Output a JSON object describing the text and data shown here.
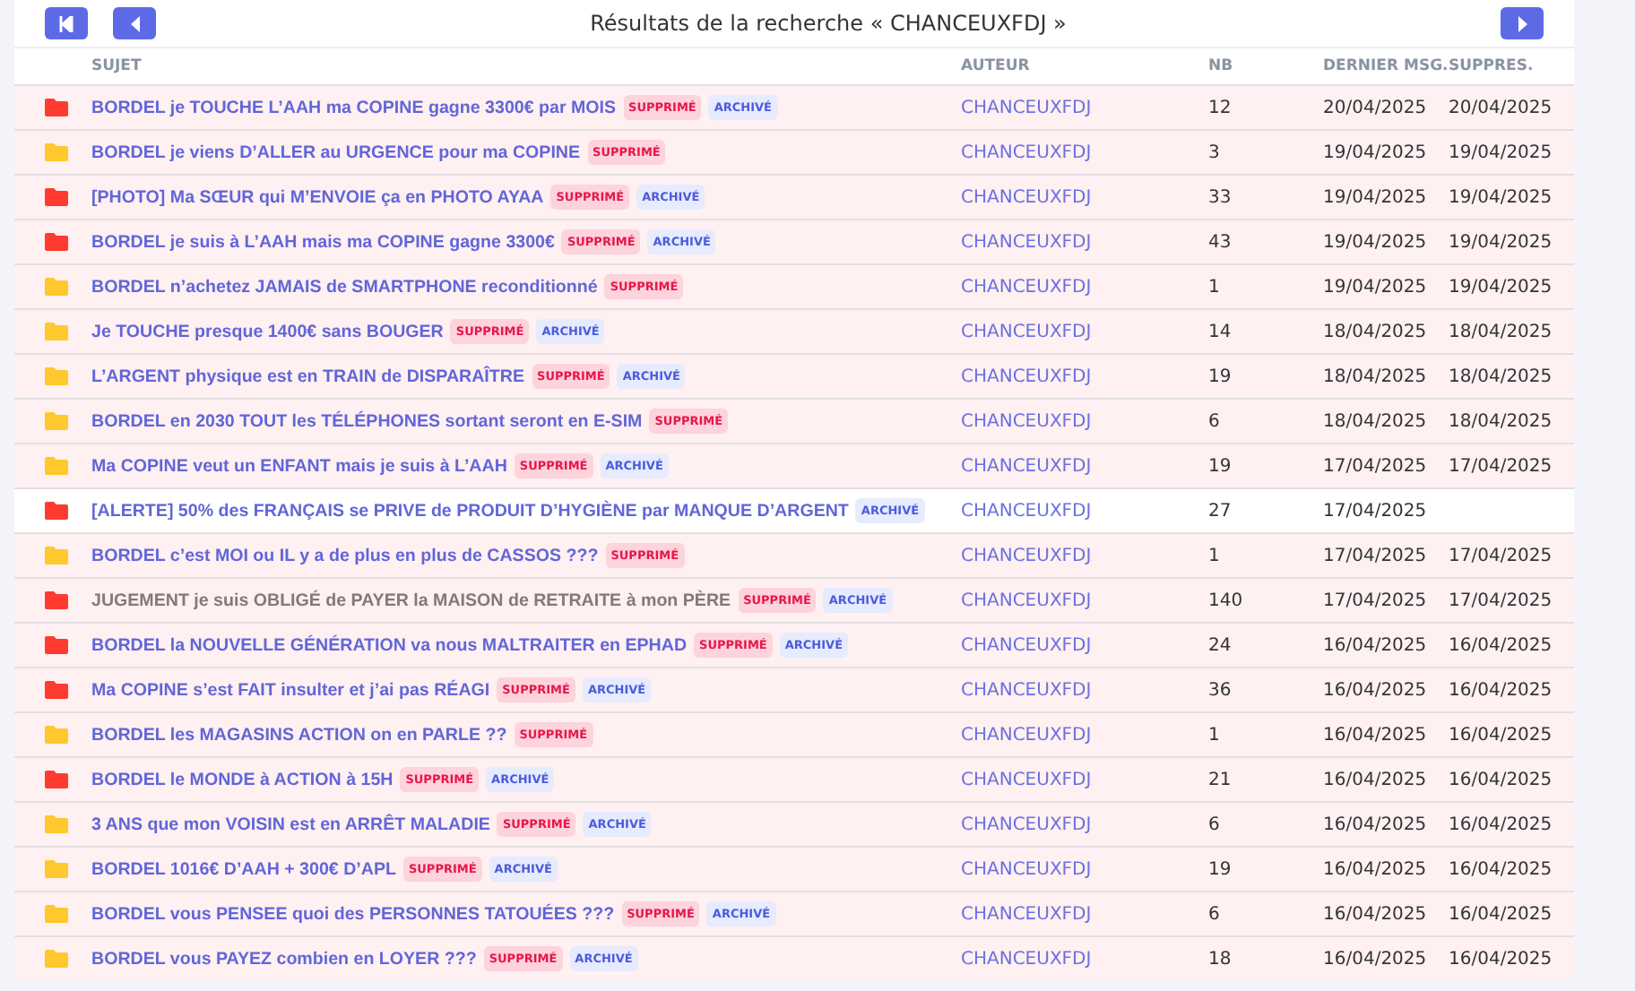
{
  "toolbar": {
    "title": "Résultats de la recherche « CHANCEUXFDJ »"
  },
  "table": {
    "columns": [
      "SUJET",
      "AUTEUR",
      "NB",
      "DERNIER MSG.",
      "SUPPRES."
    ],
    "rows": [
      {
        "subject": "BORDEL je TOUCHE L’AAH ma COPINE gagne 3300€ par MOIS",
        "color": "#ff3b30",
        "deleted": true,
        "visited": false,
        "tags": [
          {
            "kind": "deleted",
            "label": "SUPPRIMÉ"
          },
          {
            "kind": "archived",
            "label": "ARCHIVÉ"
          }
        ],
        "author": "CHANCEUXFDJ",
        "count": "12",
        "last": "20/04/2025",
        "removed": "20/04/2025"
      },
      {
        "subject": "BORDEL je viens D’ALLER au URGENCE pour ma COPINE",
        "color": "#ffc82c",
        "deleted": true,
        "visited": false,
        "tags": [
          {
            "kind": "deleted",
            "label": "SUPPRIMÉ"
          }
        ],
        "author": "CHANCEUXFDJ",
        "count": "3",
        "last": "19/04/2025",
        "removed": "19/04/2025"
      },
      {
        "subject": "[PHOTO] Ma SŒUR qui M’ENVOIE ça en PHOTO AYAA",
        "color": "#ff3b30",
        "deleted": true,
        "visited": false,
        "tags": [
          {
            "kind": "deleted",
            "label": "SUPPRIMÉ"
          },
          {
            "kind": "archived",
            "label": "ARCHIVÉ"
          }
        ],
        "author": "CHANCEUXFDJ",
        "count": "33",
        "last": "19/04/2025",
        "removed": "19/04/2025"
      },
      {
        "subject": "BORDEL je suis à L’AAH mais ma COPINE gagne 3300€",
        "color": "#ff3b30",
        "deleted": true,
        "visited": false,
        "tags": [
          {
            "kind": "deleted",
            "label": "SUPPRIMÉ"
          },
          {
            "kind": "archived",
            "label": "ARCHIVÉ"
          }
        ],
        "author": "CHANCEUXFDJ",
        "count": "43",
        "last": "19/04/2025",
        "removed": "19/04/2025"
      },
      {
        "subject": "BORDEL n’achetez JAMAIS de SMARTPHONE reconditionné",
        "color": "#ffc82c",
        "deleted": true,
        "visited": false,
        "tags": [
          {
            "kind": "deleted",
            "label": "SUPPRIMÉ"
          }
        ],
        "author": "CHANCEUXFDJ",
        "count": "1",
        "last": "19/04/2025",
        "removed": "19/04/2025"
      },
      {
        "subject": "Je TOUCHE presque 1400€ sans BOUGER",
        "color": "#ffc82c",
        "deleted": true,
        "visited": false,
        "tags": [
          {
            "kind": "deleted",
            "label": "SUPPRIMÉ"
          },
          {
            "kind": "archived",
            "label": "ARCHIVÉ"
          }
        ],
        "author": "CHANCEUXFDJ",
        "count": "14",
        "last": "18/04/2025",
        "removed": "18/04/2025"
      },
      {
        "subject": "L’ARGENT physique est en TRAIN de DISPARAÎTRE",
        "color": "#ffc82c",
        "deleted": true,
        "visited": false,
        "tags": [
          {
            "kind": "deleted",
            "label": "SUPPRIMÉ"
          },
          {
            "kind": "archived",
            "label": "ARCHIVÉ"
          }
        ],
        "author": "CHANCEUXFDJ",
        "count": "19",
        "last": "18/04/2025",
        "removed": "18/04/2025"
      },
      {
        "subject": "BORDEL en 2030 TOUT les TÉLÉPHONES sortant seront en E-SIM",
        "color": "#ffc82c",
        "deleted": true,
        "visited": false,
        "tags": [
          {
            "kind": "deleted",
            "label": "SUPPRIMÉ"
          }
        ],
        "author": "CHANCEUXFDJ",
        "count": "6",
        "last": "18/04/2025",
        "removed": "18/04/2025"
      },
      {
        "subject": "Ma COPINE veut un ENFANT mais je suis à L’AAH",
        "color": "#ffc82c",
        "deleted": true,
        "visited": false,
        "tags": [
          {
            "kind": "deleted",
            "label": "SUPPRIMÉ"
          },
          {
            "kind": "archived",
            "label": "ARCHIVÉ"
          }
        ],
        "author": "CHANCEUXFDJ",
        "count": "19",
        "last": "17/04/2025",
        "removed": "17/04/2025"
      },
      {
        "subject": "[ALERTE] 50% des FRANÇAIS se PRIVE de PRODUIT D’HYGIÈNE par MANQUE D’ARGENT",
        "color": "#ff3b30",
        "deleted": false,
        "visited": false,
        "tags": [
          {
            "kind": "archived",
            "label": "ARCHIVÉ"
          }
        ],
        "author": "CHANCEUXFDJ",
        "count": "27",
        "last": "17/04/2025"
      },
      {
        "subject": "BORDEL c’est MOI ou IL y a de plus en plus de CASSOS ???",
        "color": "#ffc82c",
        "deleted": true,
        "visited": false,
        "tags": [
          {
            "kind": "deleted",
            "label": "SUPPRIMÉ"
          }
        ],
        "author": "CHANCEUXFDJ",
        "count": "1",
        "last": "17/04/2025",
        "removed": "17/04/2025"
      },
      {
        "subject": "JUGEMENT je suis OBLIGÉ de PAYER la MAISON de RETRAITE à mon PÈRE",
        "color": "#ff3b30",
        "deleted": true,
        "visited": true,
        "tags": [
          {
            "kind": "deleted",
            "label": "SUPPRIMÉ"
          },
          {
            "kind": "archived",
            "label": "ARCHIVÉ"
          }
        ],
        "author": "CHANCEUXFDJ",
        "count": "140",
        "last": "17/04/2025",
        "removed": "17/04/2025"
      },
      {
        "subject": "BORDEL la NOUVELLE GÉNÉRATION va nous MALTRAITER en EPHAD",
        "color": "#ff3b30",
        "deleted": true,
        "visited": false,
        "tags": [
          {
            "kind": "deleted",
            "label": "SUPPRIMÉ"
          },
          {
            "kind": "archived",
            "label": "ARCHIVÉ"
          }
        ],
        "author": "CHANCEUXFDJ",
        "count": "24",
        "last": "16/04/2025",
        "removed": "16/04/2025"
      },
      {
        "subject": "Ma COPINE s’est FAIT insulter et j’ai pas RÉAGI",
        "color": "#ff3b30",
        "deleted": true,
        "visited": false,
        "tags": [
          {
            "kind": "deleted",
            "label": "SUPPRIMÉ"
          },
          {
            "kind": "archived",
            "label": "ARCHIVÉ"
          }
        ],
        "author": "CHANCEUXFDJ",
        "count": "36",
        "last": "16/04/2025",
        "removed": "16/04/2025"
      },
      {
        "subject": "BORDEL les MAGASINS ACTION on en PARLE ??",
        "color": "#ffc82c",
        "deleted": true,
        "visited": false,
        "tags": [
          {
            "kind": "deleted",
            "label": "SUPPRIMÉ"
          }
        ],
        "author": "CHANCEUXFDJ",
        "count": "1",
        "last": "16/04/2025",
        "removed": "16/04/2025"
      },
      {
        "subject": "BORDEL le MONDE à ACTION à 15H",
        "color": "#ff3b30",
        "deleted": true,
        "visited": false,
        "tags": [
          {
            "kind": "deleted",
            "label": "SUPPRIMÉ"
          },
          {
            "kind": "archived",
            "label": "ARCHIVÉ"
          }
        ],
        "author": "CHANCEUXFDJ",
        "count": "21",
        "last": "16/04/2025",
        "removed": "16/04/2025"
      },
      {
        "subject": "3 ANS que mon VOISIN est en ARRÊT MALADIE",
        "color": "#ffc82c",
        "deleted": true,
        "visited": false,
        "tags": [
          {
            "kind": "deleted",
            "label": "SUPPRIMÉ"
          },
          {
            "kind": "archived",
            "label": "ARCHIVÉ"
          }
        ],
        "author": "CHANCEUXFDJ",
        "count": "6",
        "last": "16/04/2025",
        "removed": "16/04/2025"
      },
      {
        "subject": "BORDEL 1016€ D’AAH + 300€ D’APL",
        "color": "#ffc82c",
        "deleted": true,
        "visited": false,
        "tags": [
          {
            "kind": "deleted",
            "label": "SUPPRIMÉ"
          },
          {
            "kind": "archived",
            "label": "ARCHIVÉ"
          }
        ],
        "author": "CHANCEUXFDJ",
        "count": "19",
        "last": "16/04/2025",
        "removed": "16/04/2025"
      },
      {
        "subject": "BORDEL vous PENSEE quoi des PERSONNES TATOUÉES ???",
        "color": "#ffc82c",
        "deleted": true,
        "visited": false,
        "tags": [
          {
            "kind": "deleted",
            "label": "SUPPRIMÉ"
          },
          {
            "kind": "archived",
            "label": "ARCHIVÉ"
          }
        ],
        "author": "CHANCEUXFDJ",
        "count": "6",
        "last": "16/04/2025",
        "removed": "16/04/2025"
      },
      {
        "subject": "BORDEL vous PAYEZ combien en LOYER ???",
        "color": "#ffc82c",
        "deleted": true,
        "visited": false,
        "tags": [
          {
            "kind": "deleted",
            "label": "SUPPRIMÉ"
          },
          {
            "kind": "archived",
            "label": "ARCHIVÉ"
          }
        ],
        "author": "CHANCEUXFDJ",
        "count": "18",
        "last": "16/04/2025",
        "removed": "16/04/2025"
      }
    ]
  }
}
